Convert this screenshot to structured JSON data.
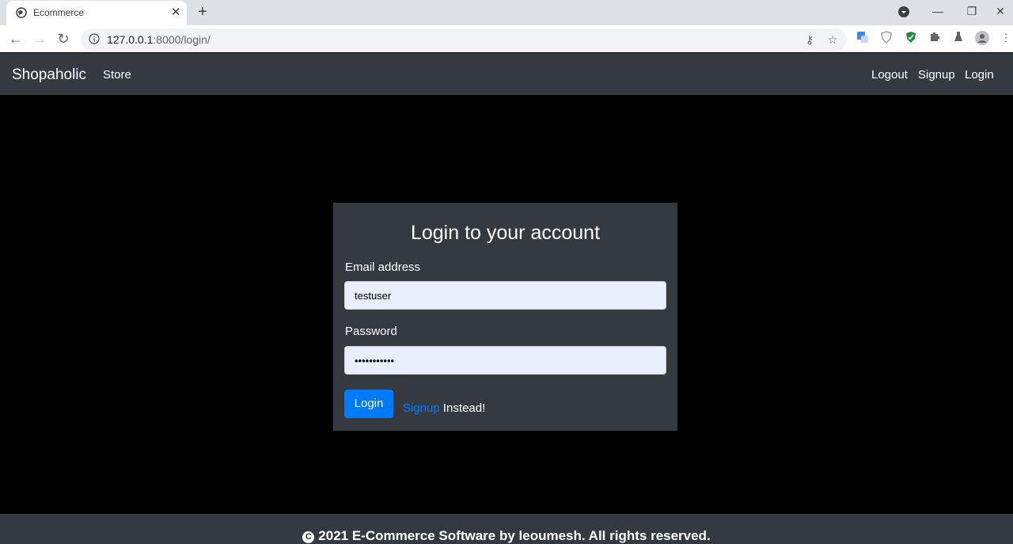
{
  "browser": {
    "tab_title": "Ecommerce",
    "url_host": "127.0.0.1",
    "url_path": ":8000/login/"
  },
  "navbar": {
    "brand": "Shopaholic",
    "store": "Store",
    "logout": "Logout",
    "signup": "Signup",
    "login": "Login"
  },
  "form": {
    "heading": "Login to your account",
    "email_label": "Email address",
    "email_value": "testuser",
    "password_label": "Password",
    "password_value": "•••••••••••",
    "submit_label": "Login",
    "signup_link": "Signup",
    "signup_suffix": " Instead!"
  },
  "footer": {
    "text": "2021 E-Commerce Software by leoumesh. All rights reserved."
  },
  "colors": {
    "navbar_bg": "#343a40",
    "primary": "#007bff",
    "autofill_bg": "#e8f0fe"
  }
}
